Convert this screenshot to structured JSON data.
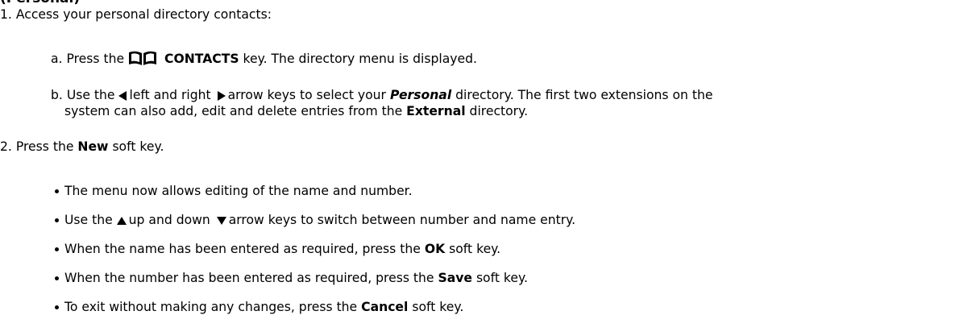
{
  "heading_fragment": "(Personal)",
  "steps": [
    {
      "number": "1.",
      "text": "Access your personal directory contacts:",
      "substeps": [
        {
          "letter": "a.",
          "prefix": "Press the",
          "key": "CONTACTS",
          "suffix": "key. The directory menu is displayed.",
          "icon": "book-icon"
        },
        {
          "letter": "b.",
          "prefix": "Use the",
          "mid1": "left and right",
          "mid2": "arrow keys to select your",
          "personal": "Personal",
          "mid3": "directory. The first two extensions on the",
          "line2_pre": "system can also add, edit and delete entries from the",
          "external": "External",
          "line2_post": "directory."
        }
      ]
    },
    {
      "number": "2.",
      "pre": "Press the",
      "key": "New",
      "post": "soft key.",
      "bullets": [
        {
          "text": "The menu now allows editing of the name and number."
        },
        {
          "pre": "Use the",
          "mid": "up and down",
          "post": "arrow keys to switch between number and name entry."
        },
        {
          "pre": "When the name has been entered as required, press the",
          "key": "OK",
          "post": "soft key."
        },
        {
          "pre": "When the number has been entered as required, press the",
          "key": "Save",
          "post": "soft key."
        },
        {
          "pre": "To exit without making any changes, press the",
          "key": "Cancel",
          "post": "soft key."
        }
      ]
    }
  ]
}
